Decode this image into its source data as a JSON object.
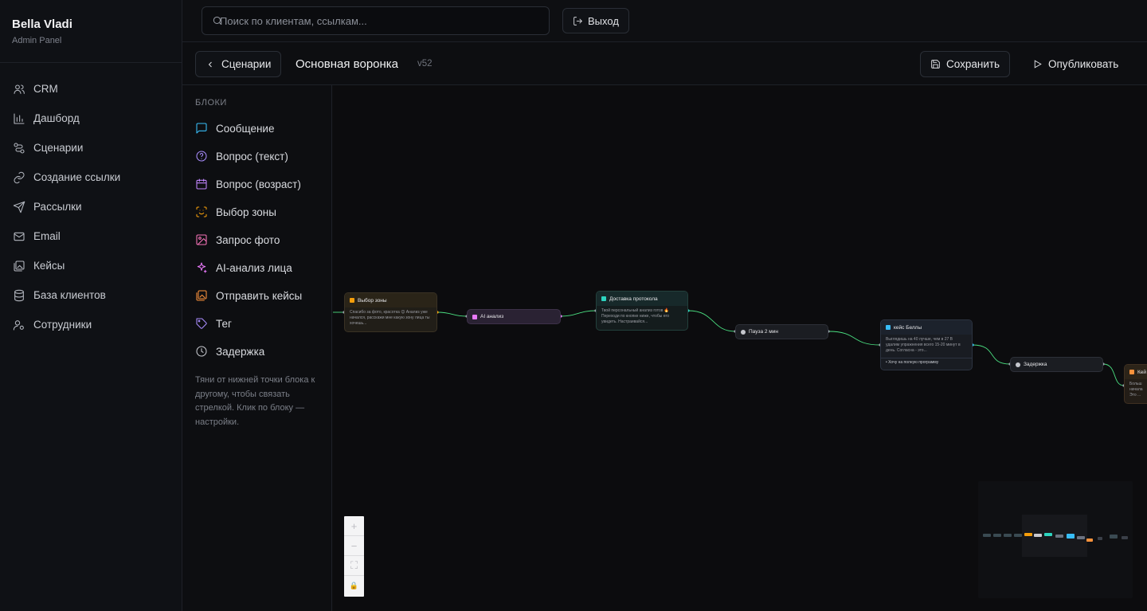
{
  "brand": {
    "name": "Bella Vladi",
    "subtitle": "Admin Panel"
  },
  "nav": [
    {
      "label": "CRM",
      "icon": "users-icon"
    },
    {
      "label": "Дашборд",
      "icon": "bar-chart-icon"
    },
    {
      "label": "Сценарии",
      "icon": "workflow-icon"
    },
    {
      "label": "Создание ссылки",
      "icon": "link-icon"
    },
    {
      "label": "Рассылки",
      "icon": "send-icon"
    },
    {
      "label": "Email",
      "icon": "mail-icon"
    },
    {
      "label": "Кейсы",
      "icon": "images-icon"
    },
    {
      "label": "База клиентов",
      "icon": "database-icon"
    },
    {
      "label": "Сотрудники",
      "icon": "user-cog-icon"
    }
  ],
  "topbar": {
    "search_placeholder": "Поиск по клиентам, ссылкам...",
    "logout_label": "Выход"
  },
  "editor": {
    "back_label": "Сценарии",
    "title": "Основная воронка",
    "version": "v52",
    "save_label": "Сохранить",
    "publish_label": "Опубликовать"
  },
  "blocks": {
    "title": "БЛОКИ",
    "items": [
      {
        "label": "Сообщение",
        "icon": "message-icon",
        "color": "#38bdf8"
      },
      {
        "label": "Вопрос (текст)",
        "icon": "question-icon",
        "color": "#a78bfa"
      },
      {
        "label": "Вопрос (возраст)",
        "icon": "calendar-icon",
        "color": "#c084fc"
      },
      {
        "label": "Выбор зоны",
        "icon": "scan-face-icon",
        "color": "#f59e0b"
      },
      {
        "label": "Запрос фото",
        "icon": "image-icon",
        "color": "#f472b6"
      },
      {
        "label": "AI-анализ лица",
        "icon": "sparkles-icon",
        "color": "#e879f9"
      },
      {
        "label": "Отправить кейсы",
        "icon": "images-icon",
        "color": "#fb923c"
      },
      {
        "label": "Тег",
        "icon": "tag-icon",
        "color": "#a78bfa"
      },
      {
        "label": "Задержка",
        "icon": "clock-icon",
        "color": "#c4c6cc"
      }
    ],
    "hint": "Тяни от нижней точки блока к другому, чтобы связать стрелкой. Клик по блоку — настройки."
  },
  "canvas": {
    "nodes": [
      {
        "id": "n1",
        "title": "Выбор зоны",
        "body": "Спасибо за фото, красотка 😊 Анализ уже начался, расскажи мне какую зону лица ты хочешь...",
        "accent": "#f59e0b",
        "bg": "#231f18"
      },
      {
        "id": "n2",
        "title": "AI анализ",
        "body": "",
        "accent": "#e879f9",
        "bg": "#2a2233"
      },
      {
        "id": "n3",
        "title": "Доставка протокола",
        "body": "Твой персональный анализ готов 🔥 Переходи по кнопке ниже, чтобы его увидеть. Настраивайся...",
        "accent": "#2dd4bf",
        "bg": "#15201f"
      },
      {
        "id": "n4",
        "title": "Пауза 2 мин",
        "body": "",
        "accent": "#c4c6cc",
        "bg": "#1d1f24"
      },
      {
        "id": "n5",
        "title": "кейс Беллы",
        "body": "Выглядишь на 40 лучше, чем в 27 В удалим упражнения всего 15-20 минут в день. Согласна - это...",
        "footer": "• Хочу на полную программу",
        "accent": "#38bdf8",
        "bg": "#191c22"
      },
      {
        "id": "n6",
        "title": "Задержка",
        "body": "",
        "accent": "#c4c6cc",
        "bg": "#1d1f24"
      },
      {
        "id": "n7",
        "title": "Кей",
        "body": "Больш начала Это ...",
        "accent": "#fb923c",
        "bg": "#231d17"
      }
    ],
    "zoom_controls": [
      "+",
      "−",
      "⛶",
      "🔒"
    ]
  }
}
